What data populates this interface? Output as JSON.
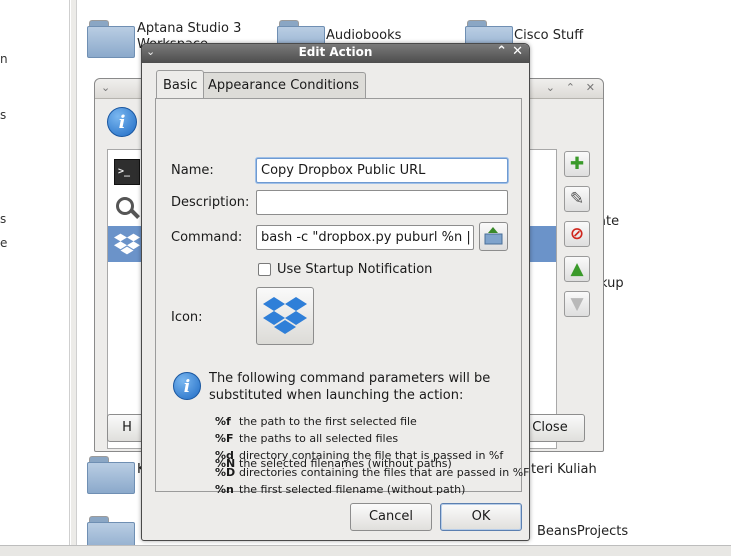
{
  "file_manager": {
    "left_fragments": [
      "n",
      "s",
      "s",
      "e"
    ],
    "folders": [
      {
        "label": "Aptana Studio 3 Workspace",
        "line1": "Aptana Studio 3",
        "line2": "Workspace"
      },
      {
        "label": "Audiobooks"
      },
      {
        "label": "Cisco Stuff"
      }
    ],
    "partial_labels": {
      "ate": "ate",
      "kup": "kup",
      "kuliah": "Materi Kuliah",
      "kuliah_visible": "teri Kuliah",
      "k_frag": "K",
      "beans": "NetBeansProjects",
      "beans_visible": "BeansProjects"
    }
  },
  "back_dialog": {
    "help_button_label": "Help",
    "help_visible": "H",
    "close_button_label": "Close",
    "close_visible": "Close",
    "terminal_glyph": ">_"
  },
  "edit_action": {
    "title": "Edit Action",
    "tabs": [
      {
        "label": "Basic",
        "active": true
      },
      {
        "label": "Appearance Conditions",
        "active": false
      }
    ],
    "name_label": "Name:",
    "name_value": "Copy Dropbox Public URL",
    "description_label": "Description:",
    "description_value": "",
    "command_label": "Command:",
    "command_value": "bash -c \"dropbox.py puburl %n | xcl",
    "startup_notification_label": "Use Startup Notification",
    "startup_notification_checked": false,
    "icon_label": "Icon:",
    "icon_name": "dropbox-icon",
    "info_text_line1": "The following command parameters will be",
    "info_text_line2": "substituted when launching the action:",
    "parameters": [
      {
        "key": "%f",
        "desc": "the path to the first selected file"
      },
      {
        "key": "%F",
        "desc": "the paths to all selected files"
      },
      {
        "key": "%d",
        "desc": "directory containing the file that is passed in %f"
      },
      {
        "key": "%D",
        "desc": "directories containing the files that are passed in %F"
      },
      {
        "key": "%n",
        "desc": "the first selected filename (without path)"
      },
      {
        "key": "%N",
        "desc": "the selected filenames (without paths)"
      }
    ],
    "cancel_label": "Cancel",
    "ok_label": "OK"
  },
  "colors": {
    "selection": "#6b93c9",
    "titlebar": "#4d4d4d",
    "dropbox_blue": "#2f7fd8",
    "folder_blue": "#8ba9cb"
  }
}
